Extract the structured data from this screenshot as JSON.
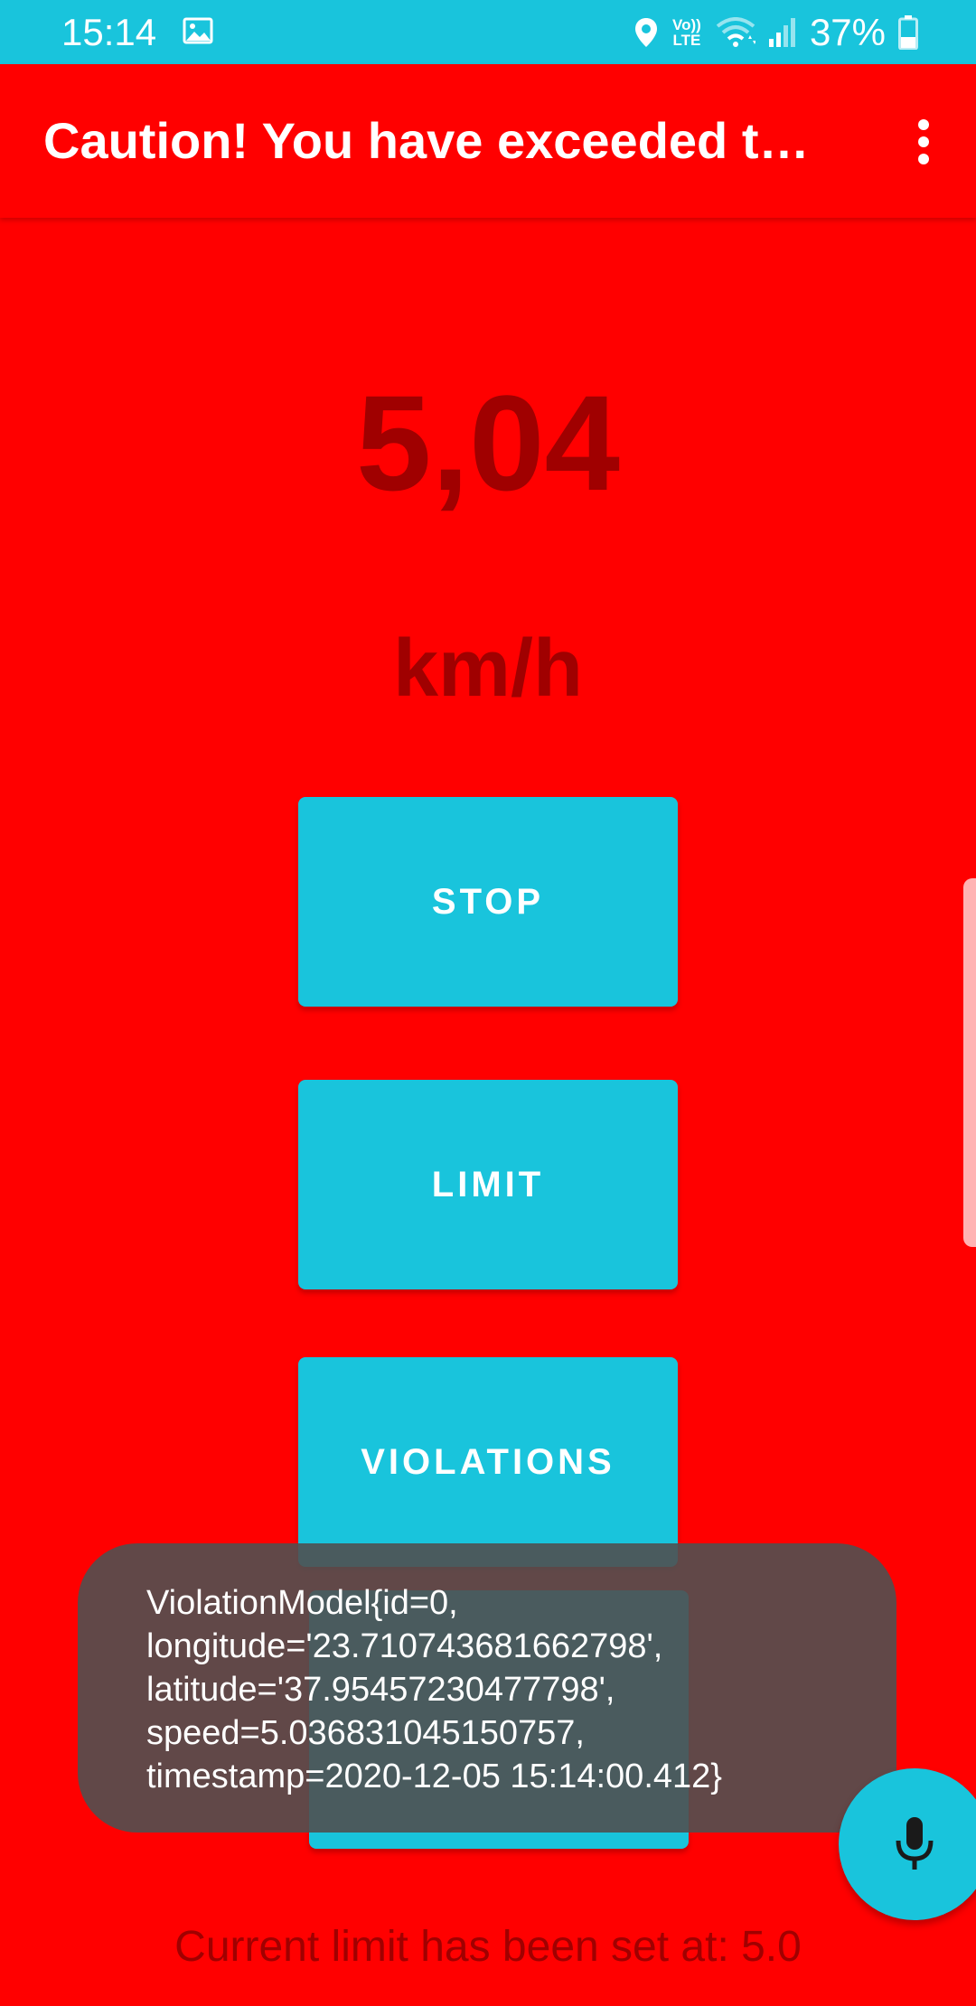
{
  "status_bar": {
    "time": "15:14",
    "lte_line1": "Vo))",
    "lte_line2": "LTE",
    "battery": "37%",
    "icons": [
      "gallery-icon",
      "location-icon",
      "volte-icon",
      "wifi-icon",
      "signal-icon",
      "battery-icon"
    ]
  },
  "app_bar": {
    "title": "Caution! You have exceeded the speed limit",
    "menu_icon": "more-vert-icon"
  },
  "speed": {
    "value": "5,04",
    "unit": "km/h"
  },
  "buttons": {
    "stop": "STOP",
    "limit": "LIMIT",
    "violations": "VIOLATIONS"
  },
  "toast": {
    "lines": [
      "ViolationModel{id=0,",
      "longitude='23.710743681662798',",
      "latitude='37.95457230477798',",
      "speed=5.036831045150757,",
      "timestamp=2020-12-05 15:14:00.412}"
    ]
  },
  "footer": {
    "limit_text": "Current limit has been set at: 5.0"
  },
  "fab": {
    "icon": "mic-icon"
  },
  "colors": {
    "background": "#ff0000",
    "accent": "#19c4dc",
    "speed_text": "#a00000",
    "toast_bg": "#505050"
  }
}
